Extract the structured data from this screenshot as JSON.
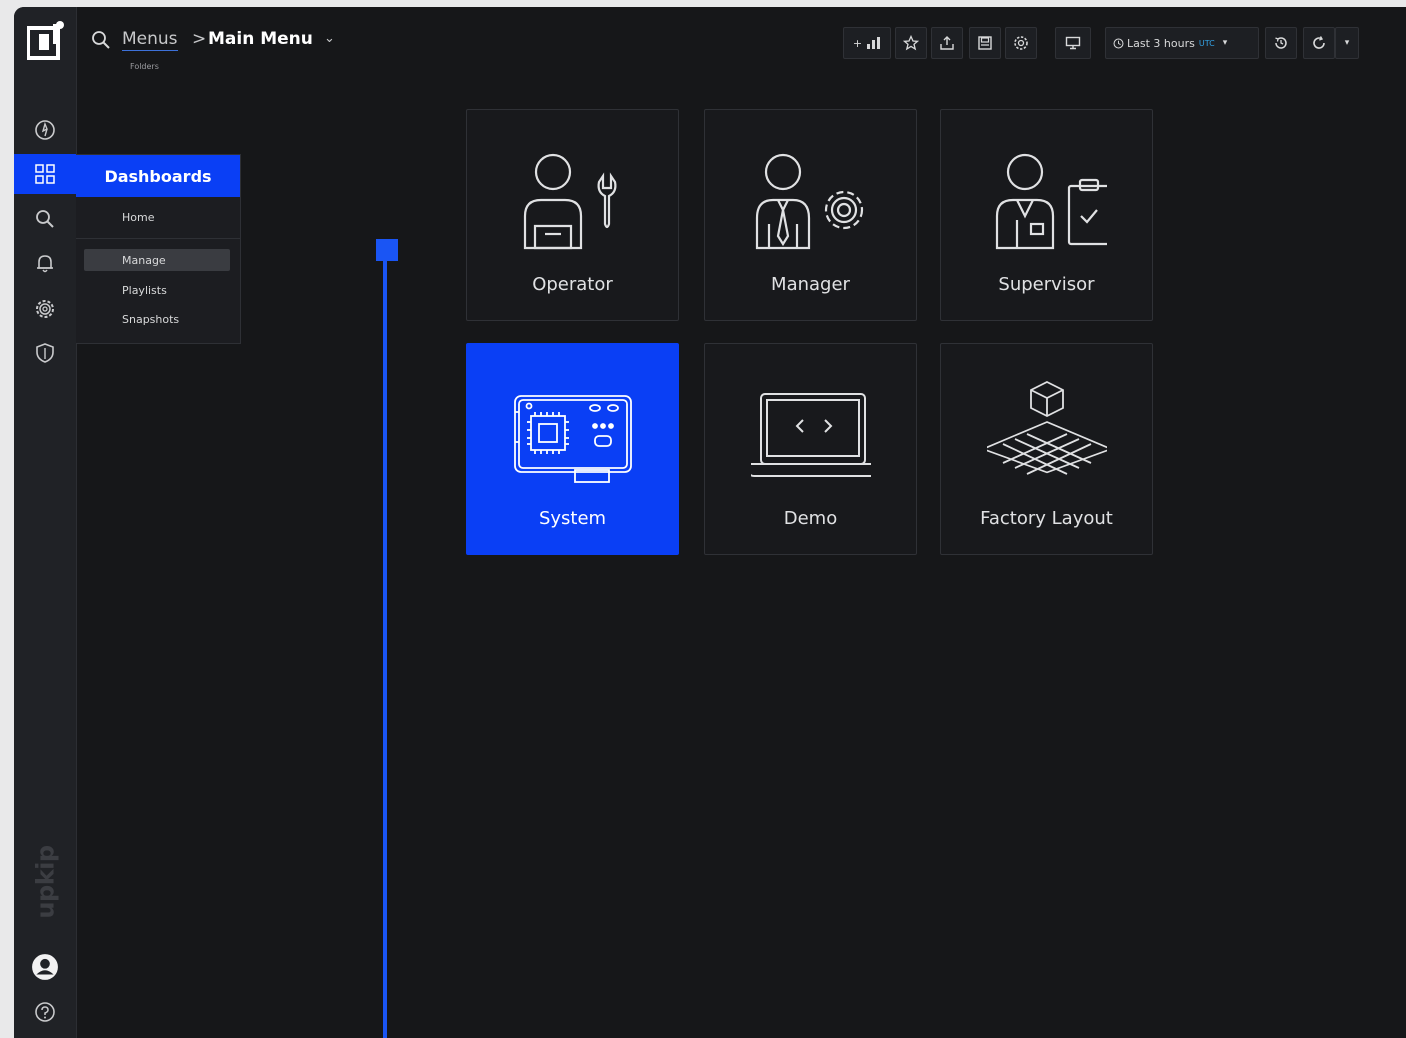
{
  "colors": {
    "accent": "#0a3ff5",
    "background": "#161719",
    "sidebar": "#202226"
  },
  "breadcrumb": {
    "root": "Menus",
    "separator": ">",
    "current": "Main Menu",
    "caret": "⌄",
    "sub": "Folders"
  },
  "sidebar": {
    "brand": "upkip",
    "icons": [
      "compass-icon",
      "dashboards-grid-icon",
      "search-icon",
      "bell-icon",
      "gear-icon",
      "shield-icon"
    ],
    "bottom_icons": [
      "user-avatar-icon",
      "help-icon"
    ]
  },
  "flyout": {
    "title": "Dashboards",
    "items": [
      {
        "label": "Home"
      },
      {
        "label": "Manage"
      },
      {
        "label": "Playlists"
      },
      {
        "label": "Snapshots"
      }
    ],
    "selected": "Manage"
  },
  "toolbar": {
    "add_panel": "+",
    "time_range": "Last 3 hours",
    "timezone": "UTC",
    "dropdown_caret": "▾",
    "more_caret": "▾"
  },
  "tiles": [
    {
      "label": "Operator",
      "icon": "operator-icon"
    },
    {
      "label": "Manager",
      "icon": "manager-icon"
    },
    {
      "label": "Supervisor",
      "icon": "supervisor-icon"
    },
    {
      "label": "System",
      "icon": "system-board-icon",
      "active": true
    },
    {
      "label": "Demo",
      "icon": "laptop-code-icon"
    },
    {
      "label": "Factory Layout",
      "icon": "factory-layout-icon"
    }
  ]
}
